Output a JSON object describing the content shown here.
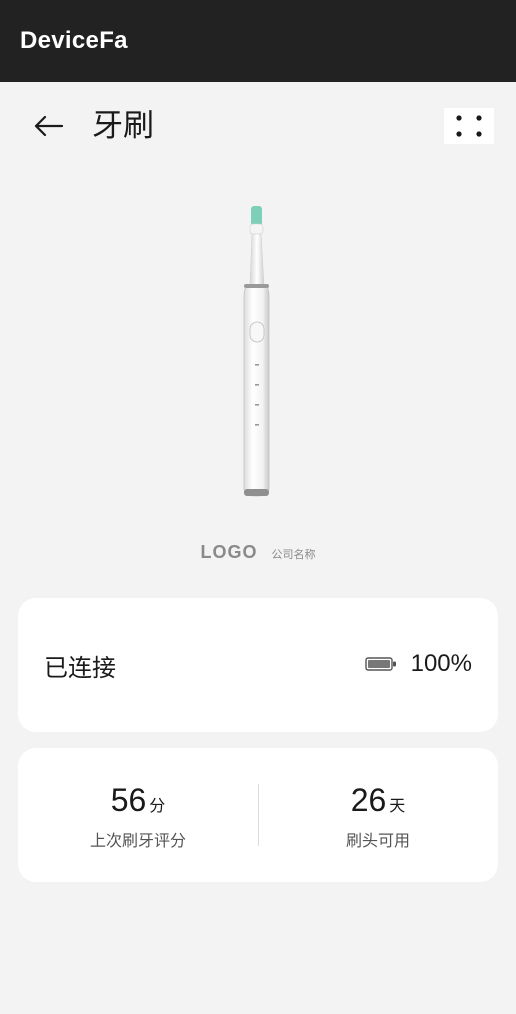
{
  "app_bar": {
    "title": "DeviceFa"
  },
  "header": {
    "title": "牙刷"
  },
  "hero": {
    "logo": "LOGO",
    "company": "公司名称"
  },
  "status": {
    "label": "已连接",
    "battery": "100%",
    "battery_level": 1.0
  },
  "stats": {
    "score": {
      "value": "56",
      "unit": "分",
      "label": "上次刷牙评分"
    },
    "head": {
      "value": "26",
      "unit": "天",
      "label": "刷头可用"
    }
  },
  "icons": {
    "back": "arrow-left-icon",
    "more": "more-dots-icon",
    "battery": "battery-icon"
  },
  "colors": {
    "app_bar": "#222222",
    "background": "#f3f3f3",
    "card": "#ffffff",
    "bristles": "#7ecfb8"
  }
}
